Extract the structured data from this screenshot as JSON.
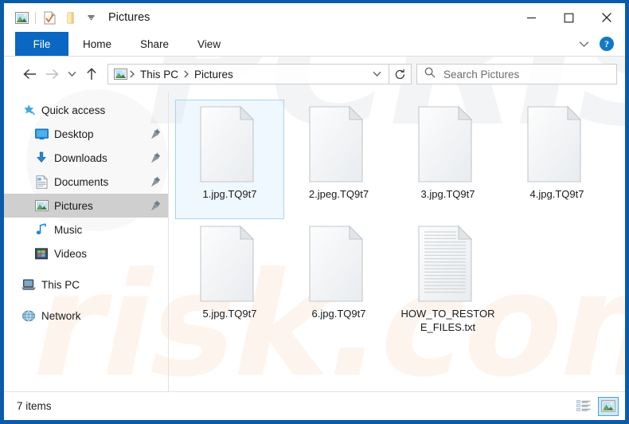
{
  "window": {
    "title": "Pictures",
    "frame_color": "#0a5ca8"
  },
  "quick_access_toolbar": {
    "items": [
      {
        "name": "pictures-folder-icon",
        "label": "Pictures properties"
      },
      {
        "name": "properties-icon",
        "label": "Properties"
      },
      {
        "name": "new-folder-icon",
        "label": "New folder"
      },
      {
        "name": "customize-chevron-icon",
        "label": "Customize Quick Access Toolbar"
      }
    ]
  },
  "window_controls": {
    "minimize": "─",
    "maximize": "□",
    "close": "✕"
  },
  "ribbon": {
    "tabs": [
      {
        "label": "File",
        "active_style": "file"
      },
      {
        "label": "Home",
        "active_style": "normal"
      },
      {
        "label": "Share",
        "active_style": "normal"
      },
      {
        "label": "View",
        "active_style": "normal"
      }
    ],
    "collapse_label": "Minimize the Ribbon",
    "help_label": "?",
    "file_tab_color": "#0a67c2"
  },
  "address_bar": {
    "back_label": "Back",
    "forward_label": "Forward",
    "recent_label": "Recent locations",
    "up_label": "Up to This PC",
    "breadcrumb": [
      "This PC",
      "Pictures"
    ],
    "breadcrumb_icon": "pictures-folder-icon",
    "dropdown_label": "Previous locations",
    "refresh_label": "Refresh"
  },
  "search": {
    "placeholder": "Search Pictures",
    "icon": "search-icon"
  },
  "sidebar": {
    "items": [
      {
        "label": "Quick access",
        "icon": "star-pin-icon",
        "indent": 0,
        "selected": false,
        "pinned": false
      },
      {
        "label": "Desktop",
        "icon": "desktop-icon",
        "indent": 1,
        "selected": false,
        "pinned": true
      },
      {
        "label": "Downloads",
        "icon": "downloads-icon",
        "indent": 1,
        "selected": false,
        "pinned": true
      },
      {
        "label": "Documents",
        "icon": "documents-icon",
        "indent": 1,
        "selected": false,
        "pinned": true
      },
      {
        "label": "Pictures",
        "icon": "pictures-icon",
        "indent": 1,
        "selected": true,
        "pinned": true
      },
      {
        "label": "Music",
        "icon": "music-icon",
        "indent": 1,
        "selected": false,
        "pinned": false
      },
      {
        "label": "Videos",
        "icon": "videos-icon",
        "indent": 1,
        "selected": false,
        "pinned": false
      },
      {
        "label": "This PC",
        "icon": "this-pc-icon",
        "indent": 0,
        "selected": false,
        "pinned": false,
        "gap_before": true
      },
      {
        "label": "Network",
        "icon": "network-icon",
        "indent": 0,
        "selected": false,
        "pinned": false,
        "gap_before": true
      }
    ]
  },
  "files": [
    {
      "name": "1.jpg.TQ9t7",
      "icon": "blank-file-icon",
      "selected": true
    },
    {
      "name": "2.jpeg.TQ9t7",
      "icon": "blank-file-icon",
      "selected": false
    },
    {
      "name": "3.jpg.TQ9t7",
      "icon": "blank-file-icon",
      "selected": false
    },
    {
      "name": "4.jpg.TQ9t7",
      "icon": "blank-file-icon",
      "selected": false
    },
    {
      "name": "5.jpg.TQ9t7",
      "icon": "blank-file-icon",
      "selected": false
    },
    {
      "name": "6.jpg.TQ9t7",
      "icon": "blank-file-icon",
      "selected": false
    },
    {
      "name": "HOW_TO_RESTORE_FILES.txt",
      "icon": "text-file-icon",
      "selected": false
    }
  ],
  "status_bar": {
    "item_count": "7 items",
    "views": [
      {
        "name": "details-view-button",
        "label": "Details view",
        "active": false
      },
      {
        "name": "large-icons-view-button",
        "label": "Large icons view",
        "active": true
      }
    ]
  },
  "watermark": {
    "text_top": "PCRISK",
    "text_bottom": "risk.com"
  }
}
